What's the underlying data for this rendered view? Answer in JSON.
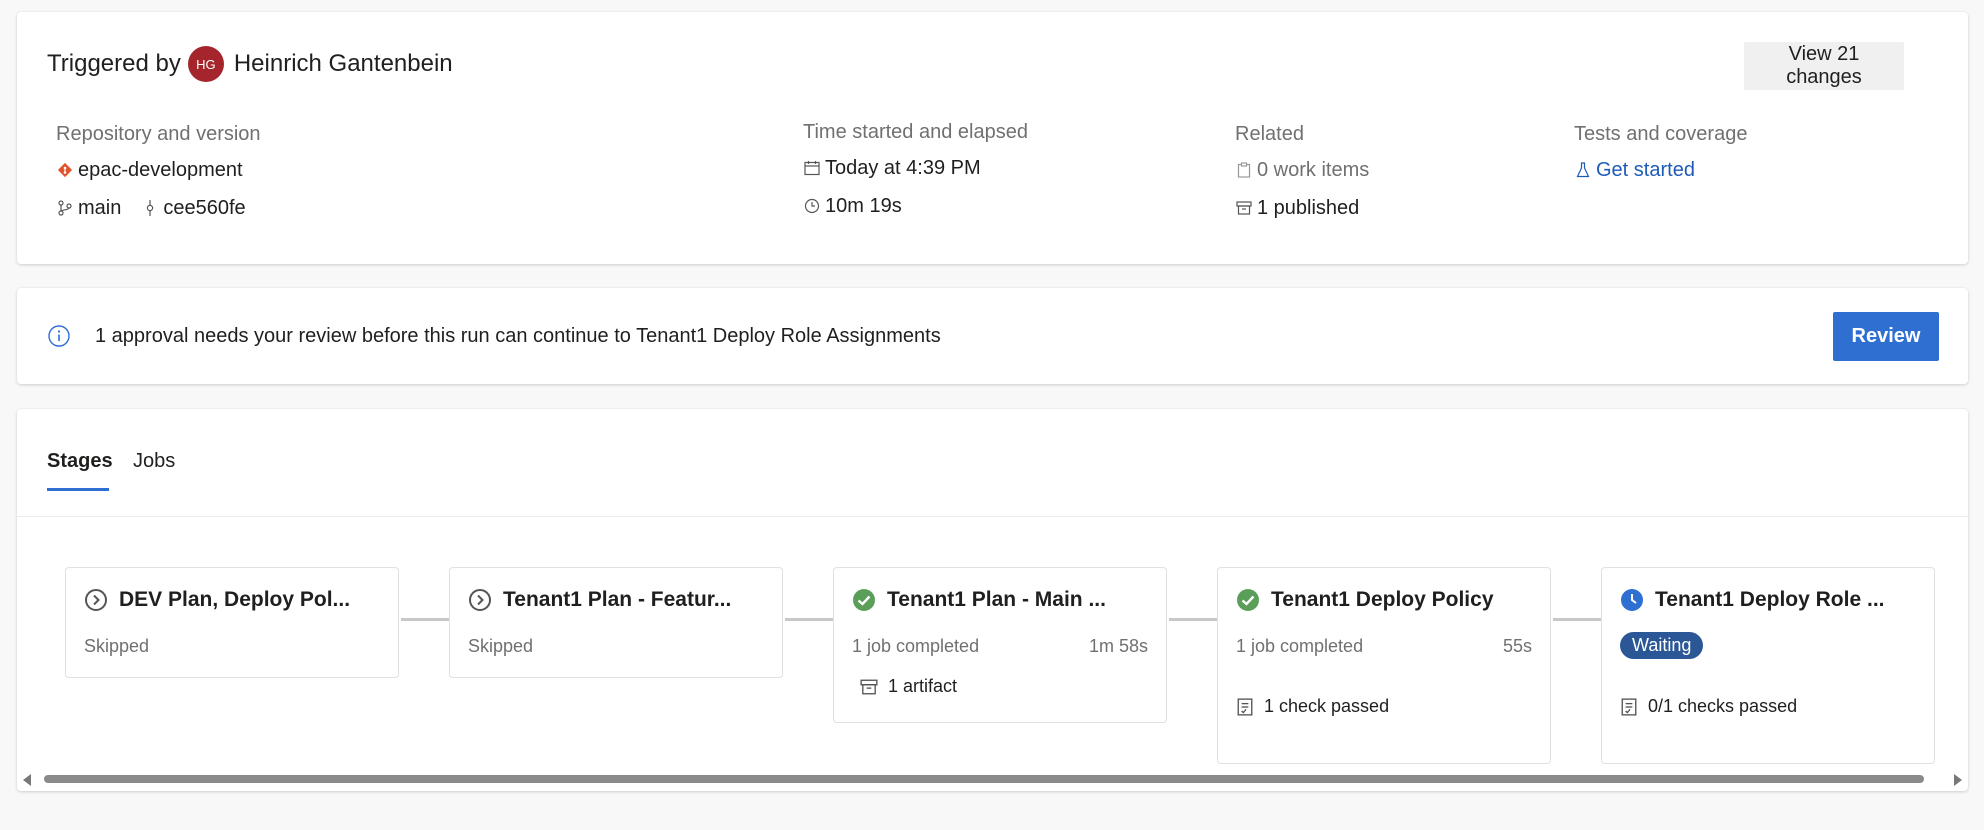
{
  "summary": {
    "triggered_by_label": "Triggered by",
    "user_initials": "HG",
    "user_name": "Heinrich Gantenbein",
    "view_changes_label": "View 21 changes",
    "repository": {
      "header": "Repository and version",
      "repo_name": "epac-development",
      "branch": "main",
      "commit": "cee560fe"
    },
    "time": {
      "header": "Time started and elapsed",
      "started": "Today at 4:39 PM",
      "elapsed": "10m 19s"
    },
    "related": {
      "header": "Related",
      "work_items": "0 work items",
      "published": "1 published"
    },
    "tests": {
      "header": "Tests and coverage",
      "link": "Get started"
    }
  },
  "banner": {
    "message": "1 approval needs your review before this run can continue to Tenant1 Deploy Role Assignments",
    "review_label": "Review"
  },
  "tabs": {
    "stages": "Stages",
    "jobs": "Jobs"
  },
  "stages": [
    {
      "name": "DEV Plan, Deploy Pol...",
      "status": "skipped",
      "subtitle": "Skipped"
    },
    {
      "name": "Tenant1 Plan - Featur...",
      "status": "skipped",
      "subtitle": "Skipped"
    },
    {
      "name": "Tenant1 Plan - Main ...",
      "status": "succeeded",
      "subtitle": "1 job completed",
      "duration": "1m 58s",
      "detail": "1 artifact"
    },
    {
      "name": "Tenant1 Deploy Policy",
      "status": "succeeded",
      "subtitle": "1 job completed",
      "duration": "55s",
      "detail": "1 check passed"
    },
    {
      "name": "Tenant1 Deploy Role ...",
      "status": "waiting",
      "badge": "Waiting",
      "detail": "0/1 checks passed"
    }
  ],
  "colors": {
    "accent": "#2e6fd1",
    "success": "#5a9e5a",
    "waiting": "#2b5797",
    "avatar": "#a4262c",
    "git": "#e0532b"
  }
}
